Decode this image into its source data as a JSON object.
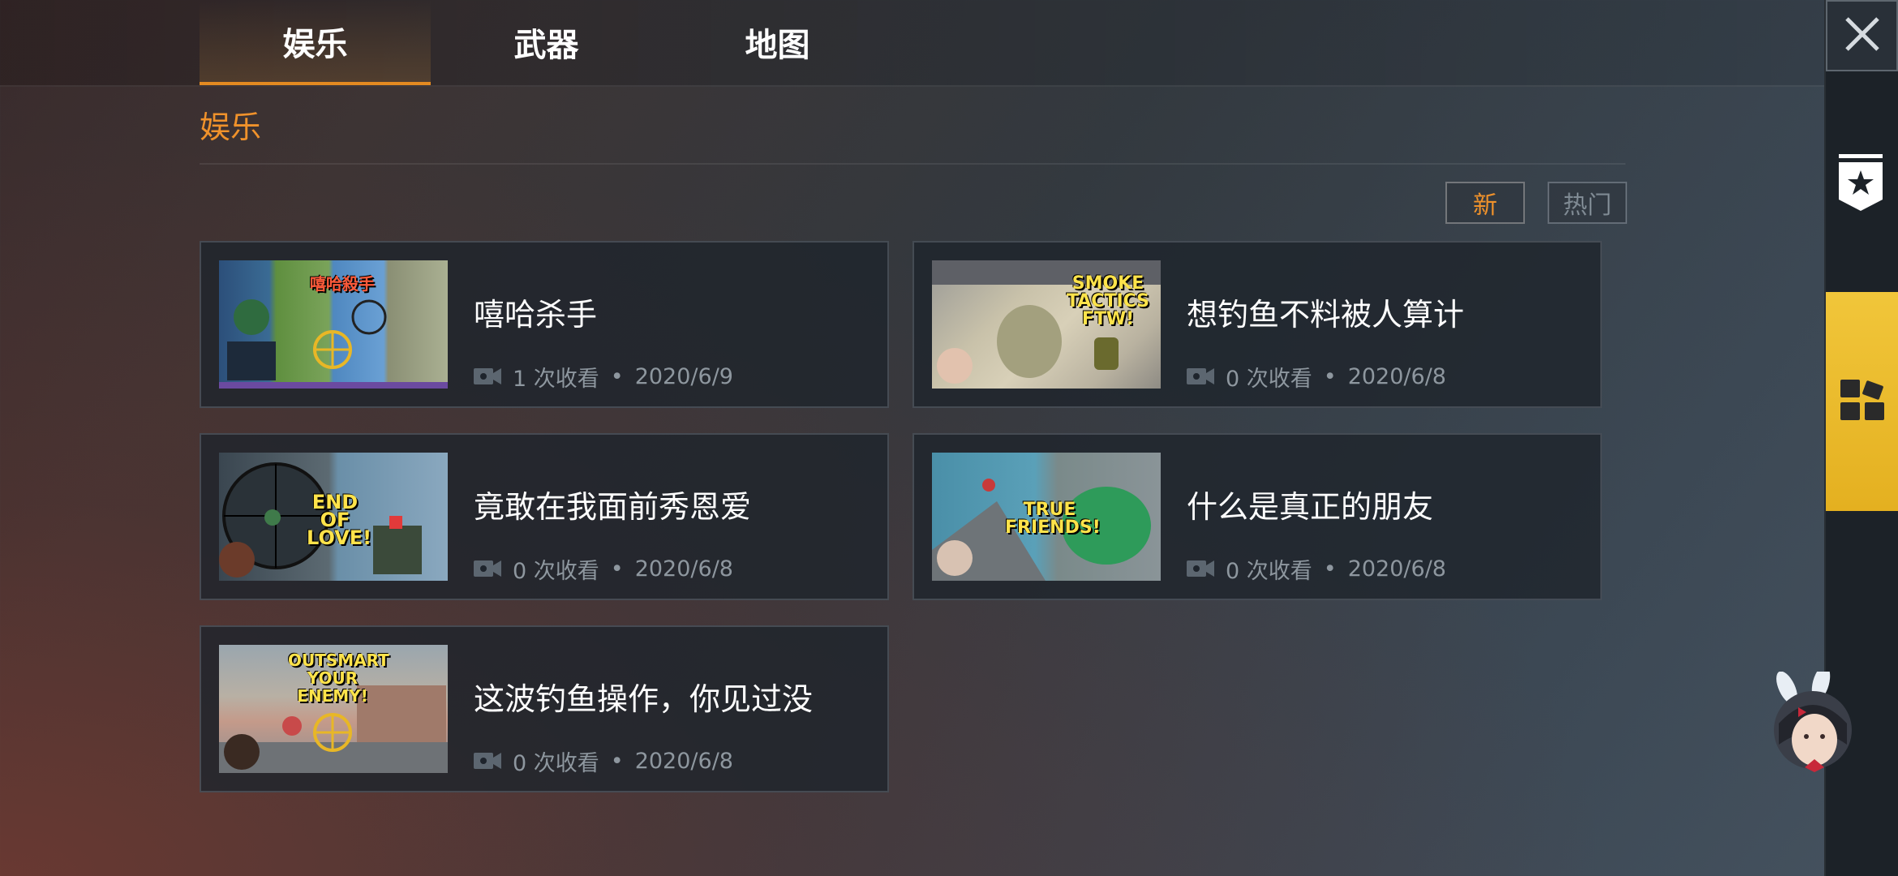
{
  "tabs": [
    {
      "label": "娱乐",
      "active": true
    },
    {
      "label": "武器",
      "active": false
    },
    {
      "label": "地图",
      "active": false
    }
  ],
  "section": {
    "title": "娱乐"
  },
  "sort": {
    "new_label": "新",
    "hot_label": "热门",
    "selected": "新"
  },
  "videos": [
    {
      "title": "嘻哈杀手",
      "views": "1 次收看",
      "date": "2020/6/9",
      "thumb_text": "嘻哈殺手"
    },
    {
      "title": "想钓鱼不料被人算计",
      "views": "0 次收看",
      "date": "2020/6/8",
      "thumb_text": "SMOKE TACTICS FTW!"
    },
    {
      "title": "竟敢在我面前秀恩爱",
      "views": "0 次收看",
      "date": "2020/6/8",
      "thumb_text": "END OF LOVE!"
    },
    {
      "title": "什么是真正的朋友",
      "views": "0 次收看",
      "date": "2020/6/8",
      "thumb_text": "TRUE FRIENDS!"
    },
    {
      "title": "这波钓鱼操作，你见过没",
      "views": "0 次收看",
      "date": "2020/6/8",
      "thumb_text": "OUTSMART YOUR ENEMY!"
    }
  ],
  "meta_separator": "•",
  "colors": {
    "accent": "#f0922b",
    "gold": "#e8b726",
    "panel": "#1c2228"
  },
  "icons": [
    "close-icon",
    "star-bookmark-icon",
    "apps-grid-icon",
    "video-camera-icon"
  ]
}
